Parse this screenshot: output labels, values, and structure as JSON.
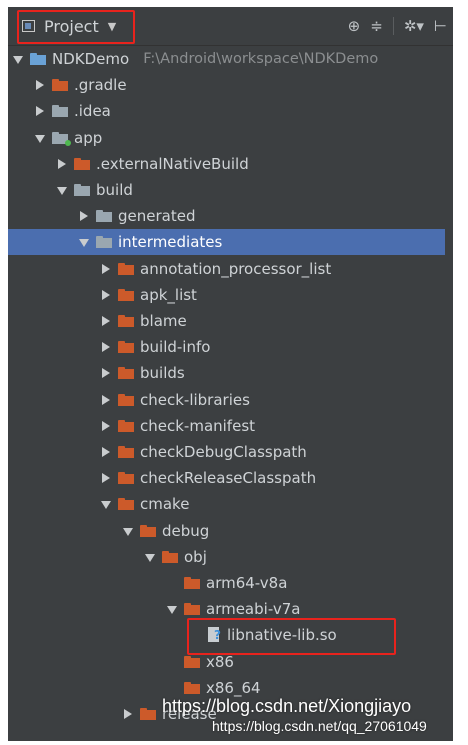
{
  "toolbar": {
    "view_label": "Project",
    "icons": [
      "target-icon",
      "collapse-icon",
      "gear-icon",
      "pin-icon"
    ]
  },
  "tree": {
    "rows": [
      {
        "label": "NDKDemo",
        "path": "F:\\Android\\workspace\\NDKDemo",
        "state": "expanded",
        "icon": "module"
      },
      {
        "label": ".gradle",
        "state": "collapsed",
        "icon": "orange"
      },
      {
        "label": ".idea",
        "state": "collapsed",
        "icon": "gray"
      },
      {
        "label": "app",
        "state": "expanded",
        "icon": "module-green"
      },
      {
        "label": ".externalNativeBuild",
        "state": "collapsed",
        "icon": "orange"
      },
      {
        "label": "build",
        "state": "expanded",
        "icon": "gray"
      },
      {
        "label": "generated",
        "state": "collapsed",
        "icon": "gray"
      },
      {
        "label": "intermediates",
        "state": "expanded",
        "icon": "gray",
        "selected": true
      },
      {
        "label": "annotation_processor_list",
        "state": "collapsed",
        "icon": "orange"
      },
      {
        "label": "apk_list",
        "state": "collapsed",
        "icon": "orange"
      },
      {
        "label": "blame",
        "state": "collapsed",
        "icon": "orange"
      },
      {
        "label": "build-info",
        "state": "collapsed",
        "icon": "orange"
      },
      {
        "label": "builds",
        "state": "collapsed",
        "icon": "orange"
      },
      {
        "label": "check-libraries",
        "state": "collapsed",
        "icon": "orange"
      },
      {
        "label": "check-manifest",
        "state": "collapsed",
        "icon": "orange"
      },
      {
        "label": "checkDebugClasspath",
        "state": "collapsed",
        "icon": "orange"
      },
      {
        "label": "checkReleaseClasspath",
        "state": "collapsed",
        "icon": "orange"
      },
      {
        "label": "cmake",
        "state": "expanded",
        "icon": "orange"
      },
      {
        "label": "debug",
        "state": "expanded",
        "icon": "orange"
      },
      {
        "label": "obj",
        "state": "expanded",
        "icon": "orange"
      },
      {
        "label": "arm64-v8a",
        "state": "none",
        "icon": "orange"
      },
      {
        "label": "armeabi-v7a",
        "state": "expanded",
        "icon": "orange"
      },
      {
        "label": "libnative-lib.so",
        "state": "none",
        "icon": "file"
      },
      {
        "label": "x86",
        "state": "none",
        "icon": "orange"
      },
      {
        "label": "x86_64",
        "state": "none",
        "icon": "orange"
      },
      {
        "label": "release",
        "state": "collapsed",
        "icon": "orange"
      }
    ]
  },
  "watermarks": {
    "line1": "https://blog.csdn.net/Xiongjiayo",
    "line2": "https://blog.csdn.net/qq_27061049"
  }
}
